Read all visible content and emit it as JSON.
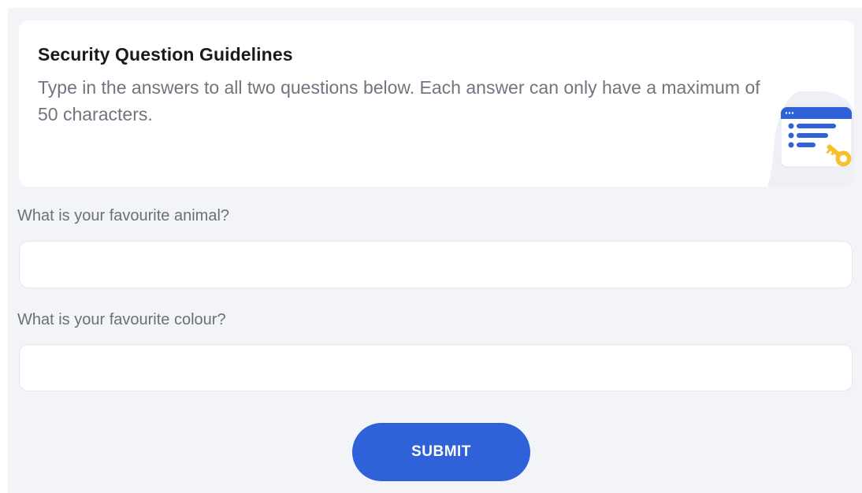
{
  "guidelines": {
    "title": "Security Question Guidelines",
    "description": "Type in the answers to all two questions below. Each answer can only have a maximum of 50 characters.",
    "illustration_icon": "form-with-key-icon"
  },
  "questions": [
    {
      "label": "What is your favourite animal?",
      "value": "",
      "placeholder": ""
    },
    {
      "label": "What is your favourite colour?",
      "value": "",
      "placeholder": ""
    }
  ],
  "submit": {
    "label": "SUBMIT"
  },
  "colors": {
    "accent": "#2f62d8",
    "key": "#f2c230",
    "background": "#f3f4f8"
  }
}
